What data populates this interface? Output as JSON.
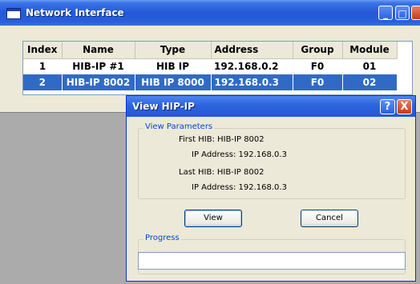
{
  "window": {
    "title": "Network Interface"
  },
  "table": {
    "columns": [
      "Index",
      "Name",
      "Type",
      "Address",
      "Group",
      "Module"
    ],
    "rows": [
      [
        "1",
        "HIB-IP #1",
        "HIB IP",
        "192.168.0.2",
        "F0",
        "01"
      ],
      [
        "2",
        "HIB-IP 8002",
        "HIB IP 8000",
        "192.168.0.3",
        "F0",
        "02"
      ]
    ],
    "selected_row_index": 2
  },
  "dialog": {
    "title": "View HIP-IP",
    "help_glyph": "?",
    "close_glyph": "X",
    "params_label": "View Parameters",
    "first_hib": "First HIB: HIB-IP 8002",
    "first_ip": "IP Address: 192.168.0.3",
    "last_hib": "Last HIB: HIB-IP 8002",
    "last_ip": "IP Address: 192.168.0.3",
    "view_label": "View",
    "cancel_label": "Cancel",
    "progress_label": "Progress",
    "progress_value": 0
  },
  "colors": {
    "titlebar": "#2458d8",
    "selection": "#316ac5",
    "group_label": "#0046d5",
    "desktop": "#ababab"
  },
  "icons": [
    "app-window-icon",
    "minimize-icon",
    "maximize-icon",
    "close-icon",
    "help-icon"
  ]
}
